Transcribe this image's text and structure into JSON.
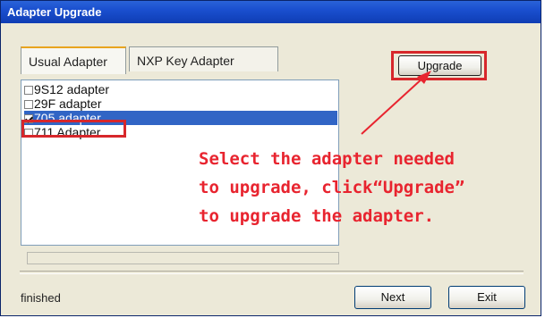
{
  "window": {
    "title": "Adapter Upgrade"
  },
  "tabs": [
    {
      "label": "Usual Adapter",
      "active": true
    },
    {
      "label": "NXP Key Adapter",
      "active": false
    }
  ],
  "adapters": [
    {
      "label": "9S12 adapter",
      "checked": false,
      "selected": false
    },
    {
      "label": "29F adapter",
      "checked": false,
      "selected": false
    },
    {
      "label": "705 adapter",
      "checked": true,
      "selected": true
    },
    {
      "label": "711 Adapter",
      "checked": false,
      "selected": false
    }
  ],
  "buttons": {
    "upgrade": "Upgrade",
    "next": "Next",
    "exit": "Exit"
  },
  "status": "finished",
  "progress": 0,
  "annotation": {
    "lines": [
      "Select the adapter needed",
      "to upgrade, click“Upgrade”",
      "to upgrade the adapter."
    ],
    "color": "#e8242f"
  },
  "colors": {
    "titlebar": "#1a4fcf",
    "selection": "#3165c5",
    "highlight_box": "#d7272b"
  }
}
